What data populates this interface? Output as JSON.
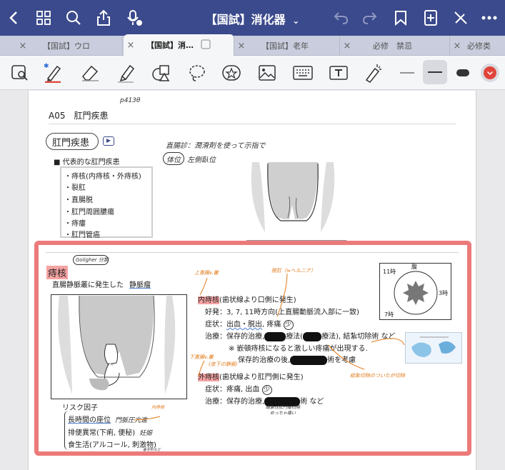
{
  "topbar": {
    "title": "【国試】消化器",
    "title_caret": "⌄",
    "bg": "#3b4a8c"
  },
  "tabs": [
    {
      "label": "【国試】ウロ"
    },
    {
      "label": "【国試】消…",
      "active": true
    },
    {
      "label": "【国試】老年"
    },
    {
      "label": "必修　禁忌"
    },
    {
      "label": "必修类"
    }
  ],
  "toolbar": {
    "tools": [
      "lasso-zoom-icon",
      "pen-icon",
      "eraser-icon",
      "highlighter-icon",
      "shapes-icon",
      "lasso-icon",
      "sticker-icon",
      "image-icon",
      "keyboard-icon",
      "textbox-icon",
      "laser-pointer-icon"
    ],
    "accent": "#e0443a"
  },
  "doc": {
    "header": "A05　肛門疾患",
    "handwritten_top": "p413θ",
    "section_title": "肛門疾患",
    "bullet_heading": "■ 代表的な肛門疾患",
    "disease_list": [
      "・痔核(内痔核・外痔核)",
      "・裂肛",
      "・直腸脱",
      "・肛門周囲膿瘍",
      "・痔瘻",
      "・肛門管癌"
    ],
    "hand_note1": "直腸診：潤滑剤を使って示指で",
    "hand_note2_circle": "体位",
    "hand_note2": "左側臥位",
    "goligher": "Goligher 分類",
    "disease_title": "痔核",
    "definition_a": "直腸静脈叢に発生した",
    "definition_b": "静脈瘤",
    "upper_annot": "上直腸v.叢",
    "prolapse_annot": "脱肛（≒ヘルニア）",
    "internal_title": "内痔核",
    "internal_sub": "(歯状線より口側に発生)",
    "internal_site": "好発：3, 7, 11時方向(上直腸動脈流入部に一致)",
    "internal_symptom_a": "症状：",
    "internal_symptom_b": "出血・脱出",
    "internal_symptom_c": ", 疼痛",
    "internal_pain_level": "少",
    "internal_treat_a": "治療：保存的治療,",
    "internal_treat_b": "療法(",
    "internal_treat_c": "療法), 結紮切除術 など",
    "internal_note1": "※ 嵌頓痔核になると激しい疼痛が出現する.",
    "internal_note2_a": "保存的治療の後,",
    "internal_note2_b": "術を考慮",
    "lower_annot": "下直腸v.叢",
    "lower_annot2": "(皮下の静脈)",
    "external_title": "外痔核",
    "external_sub": "(歯状線より肛門側に発生)",
    "external_symptom_a": "症状：疼痛, 出血",
    "external_pain_level": "少",
    "external_treat_a": "治療：保存的治療,",
    "external_treat_b": "術 など",
    "ligation_annot": "結紮切除のついたが切除",
    "ligation_annot2": "結紮性肛門瘤切除",
    "ligation_annot3": "めっちゃ痛い",
    "risk_title": "リスク因子",
    "risk1_a": "長時間の座位",
    "risk1_b": "門脈圧亢進",
    "risk2": "排便異常(下痢, 便秘)",
    "risk2_b": "妊娠",
    "risk3": "食生活(アルコール, 刺激物)",
    "risk3_note": "香辛料など",
    "internal_label_annot": "内痔核",
    "clock": {
      "top": "腹",
      "right": "3時",
      "left": "11時",
      "bottom": "7時"
    }
  }
}
